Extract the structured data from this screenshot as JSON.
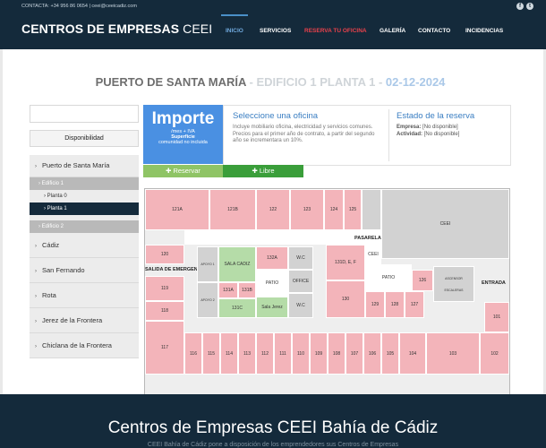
{
  "topbar": {
    "contact": "CONTACTA: +34 956 86 0654 | ceei@ceeicadiz.com",
    "social": [
      "f",
      "t"
    ]
  },
  "brand": {
    "name": "CENTROS DE EMPRESAS",
    "suffix": "CEEI"
  },
  "nav": [
    "INICIO",
    "SERVICIOS",
    "RESERVA TU OFICINA",
    "GALERÍA",
    "CONTACTO",
    "INCIDENCIAS"
  ],
  "colors": {
    "navy": "#142a3b",
    "active": "#6fa8dc",
    "highlight": "#e8414b",
    "reserved": "#f3b4ba",
    "free": "#b5dca8",
    "blue_accent": "#4a90e2"
  },
  "page": {
    "title_main": "PUERTO DE SANTA MARÍA",
    "title_mid": " - EDIFICIO 1 PLANTA 1 - ",
    "title_date": "02-12-2024"
  },
  "sidebar": {
    "availability": "Disponibilidad",
    "centers": [
      "Puerto de Santa María",
      "Cádiz",
      "San Fernando",
      "Rota",
      "Jerez de la Frontera",
      "Chiclana de la Frontera"
    ],
    "buildings": [
      "Edificio 1",
      "Edificio 2"
    ],
    "floors": [
      "Planta 0",
      "Planta 1"
    ]
  },
  "importe": {
    "title": "Importe",
    "line1": "/mes + IVA",
    "line2": "Superficie",
    "line3": "comunidad no incluida"
  },
  "office_info": {
    "heading": "Seleccione una oficina",
    "text": "Incluye mobiliario oficina, electricidad y servicios comunes. Precios para el primer año de contrato, a partir del segundo año se incrementara un 10%."
  },
  "reservation": {
    "heading": "Estado de la reserva",
    "company_label": "Empresa:",
    "company_value": "[No disponible]",
    "activity_label": "Actividad:",
    "activity_value": "[No disponible]"
  },
  "buttons": {
    "reserve": "Reservar",
    "free": "Libre"
  },
  "plan": {
    "rooms_top": [
      "121A",
      "121B",
      "122",
      "123",
      "124",
      "125"
    ],
    "rooms_bottom": [
      "117",
      "116",
      "115",
      "114",
      "113",
      "112",
      "111",
      "110",
      "109",
      "108",
      "107",
      "106",
      "105",
      "104",
      "103",
      "102"
    ],
    "rooms_left": [
      "120",
      "119",
      "118"
    ],
    "rooms_mid": [
      "132A",
      "131D, E, F",
      "131A",
      "131B",
      "131C",
      "130",
      "129",
      "128",
      "127",
      "126",
      "101"
    ],
    "labels": [
      "PASARELA",
      "CEEI",
      "SALIDA DE EMERGENCIA",
      "SALA CADIZ",
      "W.C",
      "PATIO",
      "OFFICE",
      "Sala Jerez",
      "ASCENSOR",
      "ESCALERAS",
      "ENTRADA",
      "APOYO 1",
      "APOYO 2",
      "CEEI"
    ]
  },
  "footer": {
    "title": "Centros de Empresas CEEI Bahía de Cádiz",
    "subtitle": "CEEI Bahía de Cádiz pone a disposición de los emprendedores sus Centros de Empresas"
  }
}
